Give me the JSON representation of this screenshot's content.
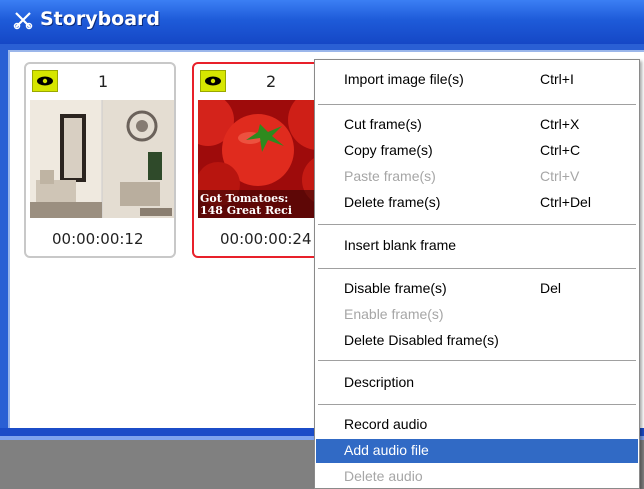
{
  "window": {
    "title": "Storyboard",
    "title_icon": "scissors-x-icon"
  },
  "frames": [
    {
      "number": "1",
      "time": "00:00:00:12",
      "selected": false
    },
    {
      "number": "2",
      "time": "00:00:00:24",
      "selected": true,
      "thumb_text_line1": "Got Tomatoes:",
      "thumb_text_line2": "148 Great Reci"
    }
  ],
  "menu": {
    "items": [
      {
        "label": "Import image file(s)",
        "shortcut": "Ctrl+I",
        "disabled": false
      },
      {
        "label": "Cut frame(s)",
        "shortcut": "Ctrl+X",
        "disabled": false
      },
      {
        "label": "Copy frame(s)",
        "shortcut": "Ctrl+C",
        "disabled": false
      },
      {
        "label": "Paste frame(s)",
        "shortcut": "Ctrl+V",
        "disabled": true
      },
      {
        "label": "Delete frame(s)",
        "shortcut": "Ctrl+Del",
        "disabled": false
      },
      {
        "label": "Insert blank frame",
        "shortcut": "",
        "disabled": false
      },
      {
        "label": "Disable frame(s)",
        "shortcut": "Del",
        "disabled": false
      },
      {
        "label": "Enable frame(s)",
        "shortcut": "",
        "disabled": true
      },
      {
        "label": "Delete Disabled frame(s)",
        "shortcut": "",
        "disabled": false
      },
      {
        "label": "Description",
        "shortcut": "",
        "disabled": false
      },
      {
        "label": "Record audio",
        "shortcut": "",
        "disabled": false
      },
      {
        "label": "Add audio file",
        "shortcut": "",
        "disabled": false,
        "highlighted": true
      },
      {
        "label": "Delete audio",
        "shortcut": "",
        "disabled": true
      }
    ]
  },
  "colors": {
    "titlebar": "#1e5bd9",
    "selection_border": "#e8202a",
    "menu_highlight": "#316ac5",
    "eye_badge": "#d6e600"
  }
}
